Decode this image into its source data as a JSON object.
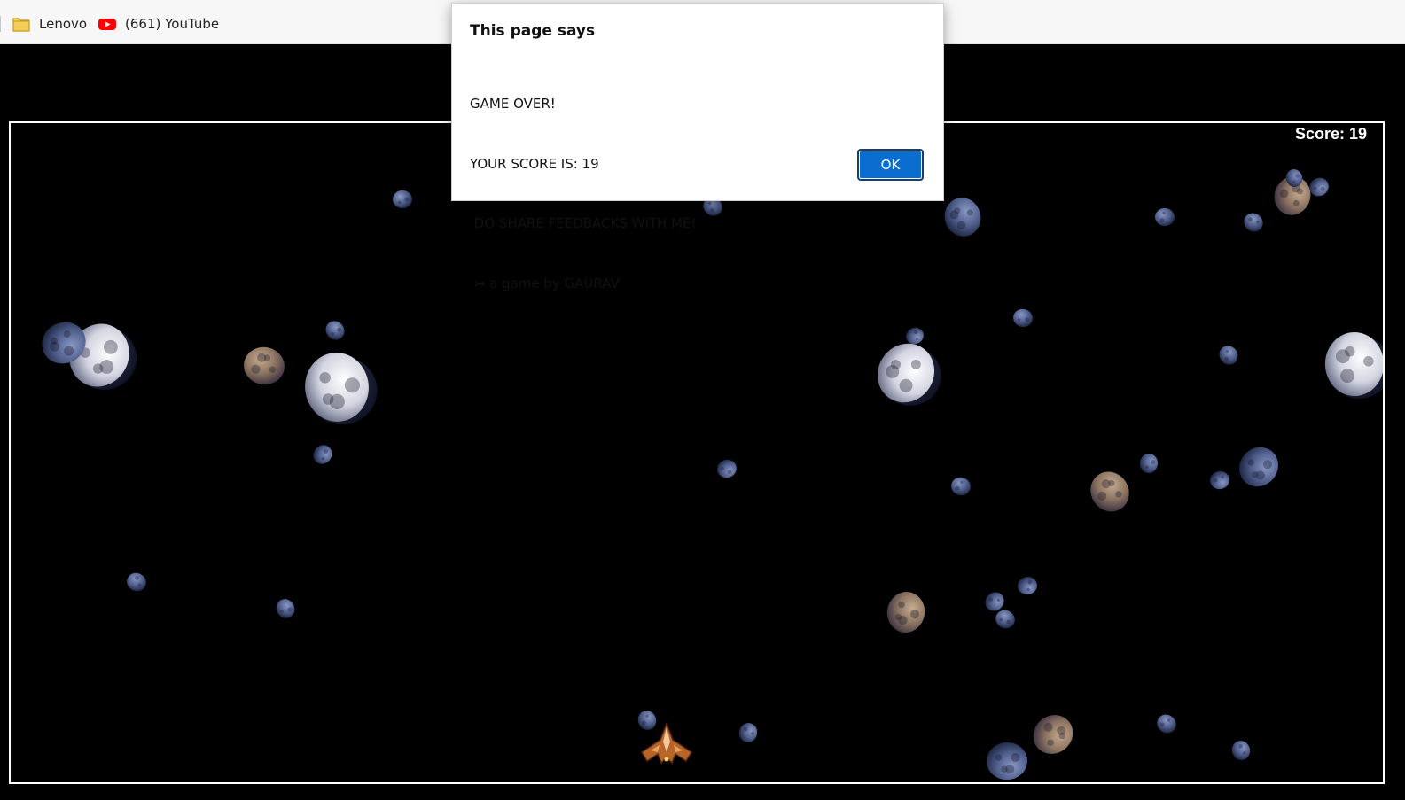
{
  "bookmarks": [
    {
      "label": "Lenovo",
      "icon": "folder-icon"
    },
    {
      "label": "(661) YouTube",
      "icon": "youtube-icon"
    }
  ],
  "game": {
    "score_text": "Score: 19",
    "score": 19
  },
  "alert": {
    "title": "This page says",
    "lines": [
      "GAME OVER!",
      "YOUR SCORE IS: 19",
      " DO SHARE FEEDBACKS WITH ME!",
      " ↣ a game by GAURAV"
    ],
    "ok_label": "OK"
  },
  "colors": {
    "background": "#000000",
    "frame_border": "#ffffff",
    "ok_button": "#0a6ed1",
    "asteroid_blue": "#5a6a9a",
    "asteroid_brown": "#9a8068",
    "asteroid_white": "#e6e6ee"
  }
}
